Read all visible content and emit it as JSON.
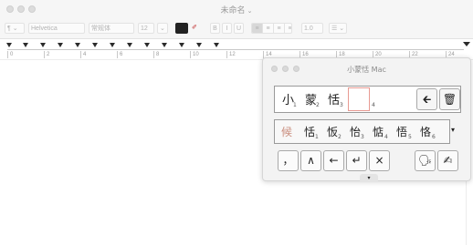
{
  "window": {
    "title": "未命名",
    "title_chevron": "⌄"
  },
  "toolbar": {
    "paragraph_style": "¶ ⌄",
    "font_family": "Helvetica",
    "font_style": "常规体",
    "font_size": "12",
    "font_size_chevron": "⌄",
    "bold": "B",
    "italic": "I",
    "underline": "U",
    "align_labels": [
      "≡",
      "≡",
      "≡",
      "≡"
    ],
    "line_spacing": "1.0",
    "list": "☰ ⌄"
  },
  "ruler": {
    "numbers": [
      "0",
      "2",
      "4",
      "6",
      "8",
      "10",
      "12",
      "14",
      "16",
      "18",
      "20",
      "22",
      "24"
    ]
  },
  "ime_window": {
    "title": "小蒙恬 Mac",
    "composition": {
      "chars": [
        "小",
        "蒙",
        "恬"
      ],
      "indices": [
        "1",
        "2",
        "3"
      ],
      "cursor_index": "4"
    },
    "back_icon": "🡰",
    "trash_icon": "🗑",
    "candidates": {
      "chars": [
        "候",
        "恬",
        "㤆",
        "怡",
        "惦",
        "悟",
        "恪"
      ],
      "indices": [
        "",
        "1",
        "2",
        "3",
        "4",
        "5",
        "6"
      ]
    },
    "more_candidates": "▾",
    "keys": {
      "comma": "，",
      "caret": "∧",
      "left_arrow": "←",
      "enter": "↵",
      "close": "×",
      "voice": "🗣",
      "handwrite": "✍"
    },
    "grip": "▾"
  },
  "colors": {
    "accent_cursor": "#e89a92",
    "candidate_highlight": "#c98d7d"
  }
}
